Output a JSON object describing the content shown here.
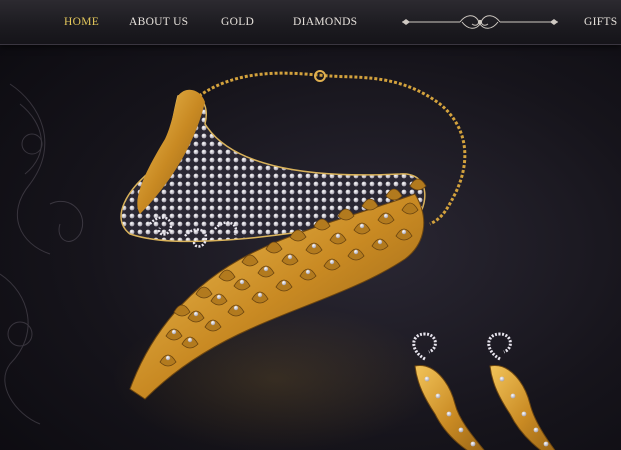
{
  "nav": {
    "items": [
      {
        "label": "HOME",
        "active": true
      },
      {
        "label": "ABOUT US",
        "active": false
      },
      {
        "label": "GOLD",
        "active": false
      },
      {
        "label": "DIAMONDS",
        "active": false
      },
      {
        "label": "GIFTS",
        "active": false
      }
    ],
    "ornament_icon": "flourish-divider-icon"
  },
  "hero": {
    "subject_icon": "jewellery-necklace-earrings-image"
  },
  "colors": {
    "active_nav": "#e3c75b",
    "nav_text": "#e7e2dc",
    "gold": "#c9932a",
    "background": "#16141b"
  }
}
